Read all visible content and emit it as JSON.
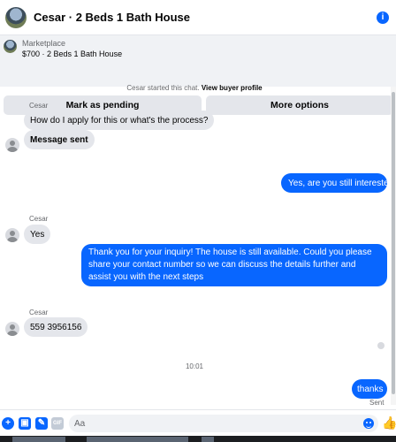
{
  "header": {
    "title": "Cesar · 2 Beds 1 Bath House",
    "info_icon": "info-icon",
    "info_glyph": "i",
    "accent": "#0866ff"
  },
  "listing": {
    "source": "Marketplace",
    "title": "$700 · 2 Beds 1 Bath House",
    "mark_pending_label": "Mark as pending",
    "more_options_label": "More options"
  },
  "chat": {
    "system_prefix": "Cesar started this chat.",
    "system_link": "View buyer profile",
    "messages": [
      {
        "from": "Cesar",
        "sender_label": "Cesar",
        "text": "How do I apply for this or what's the process?"
      },
      {
        "from": "Cesar",
        "text": "Message sent"
      },
      {
        "from": "me",
        "text": "Yes, are you still interested?"
      },
      {
        "from": "Cesar",
        "sender_label": "Cesar",
        "text": "Yes"
      },
      {
        "from": "me",
        "text": "Thank you for your inquiry! The house is still available. Could you please share your contact number so we can discuss the details further and assist you with the next steps"
      },
      {
        "from": "Cesar",
        "sender_label": "Cesar",
        "text": "559 3956156"
      },
      {
        "from": "me",
        "text": "thanks"
      }
    ],
    "timestamp": "10:01",
    "sent_status": "Sent"
  },
  "composer": {
    "placeholder": "Aa",
    "icons": [
      "plus-icon",
      "photo-icon",
      "sticker-icon",
      "gif-icon",
      "emoji-icon",
      "like-icon"
    ],
    "gif_label": "GIF"
  }
}
